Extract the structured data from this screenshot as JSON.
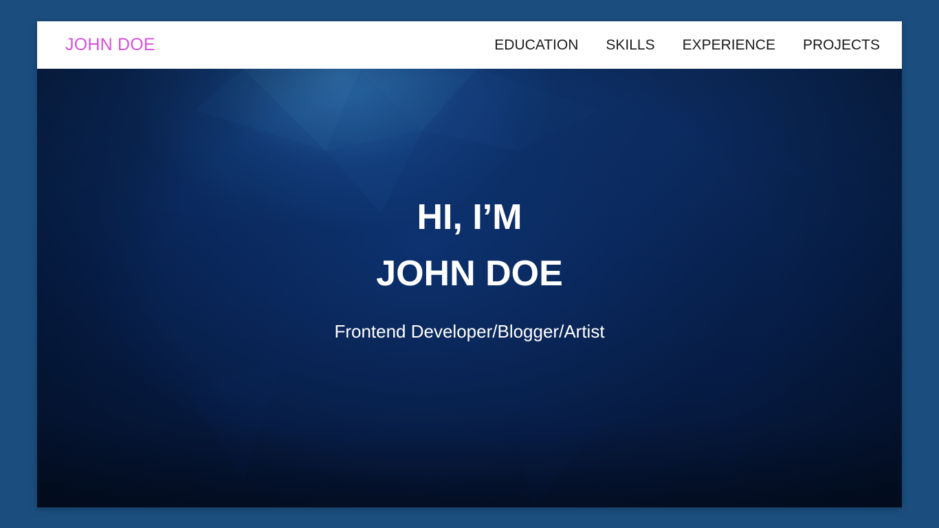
{
  "navbar": {
    "brand": "JOHN DOE",
    "links": [
      {
        "label": "EDUCATION"
      },
      {
        "label": "SKILLS"
      },
      {
        "label": "EXPERIENCE"
      },
      {
        "label": "PROJECTS"
      }
    ]
  },
  "hero": {
    "greeting": "HI, I’M",
    "name": "JOHN DOE",
    "tagline": "Frontend Developer/Blogger/Artist"
  },
  "colors": {
    "page_background": "#1b4e7e",
    "brand": "#d94fe0",
    "nav_background": "#ffffff",
    "hero_background": "#07204d",
    "hero_text": "#ffffff"
  }
}
